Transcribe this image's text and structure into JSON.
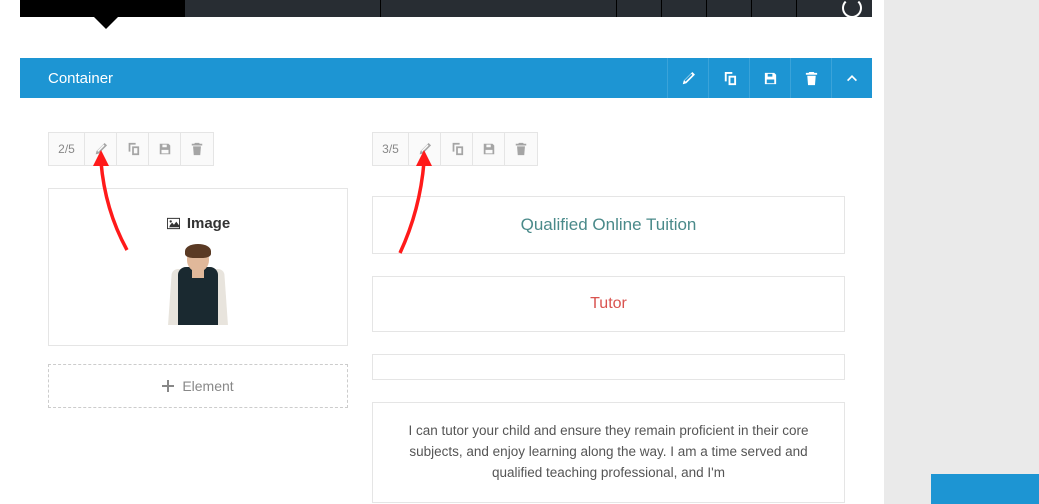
{
  "container": {
    "title": "Container"
  },
  "columns": {
    "left": {
      "ratio": "2/5",
      "image_label": "Image",
      "add_element_label": "Element"
    },
    "right": {
      "ratio": "3/5",
      "heading1": "Qualified Online Tuition",
      "heading2": "Tutor",
      "body": "I can tutor your child and ensure they remain proficient in their core subjects, and enjoy learning along the way. I am a time served and qualified teaching professional, and I'm"
    }
  },
  "right_panel_hint": ""
}
